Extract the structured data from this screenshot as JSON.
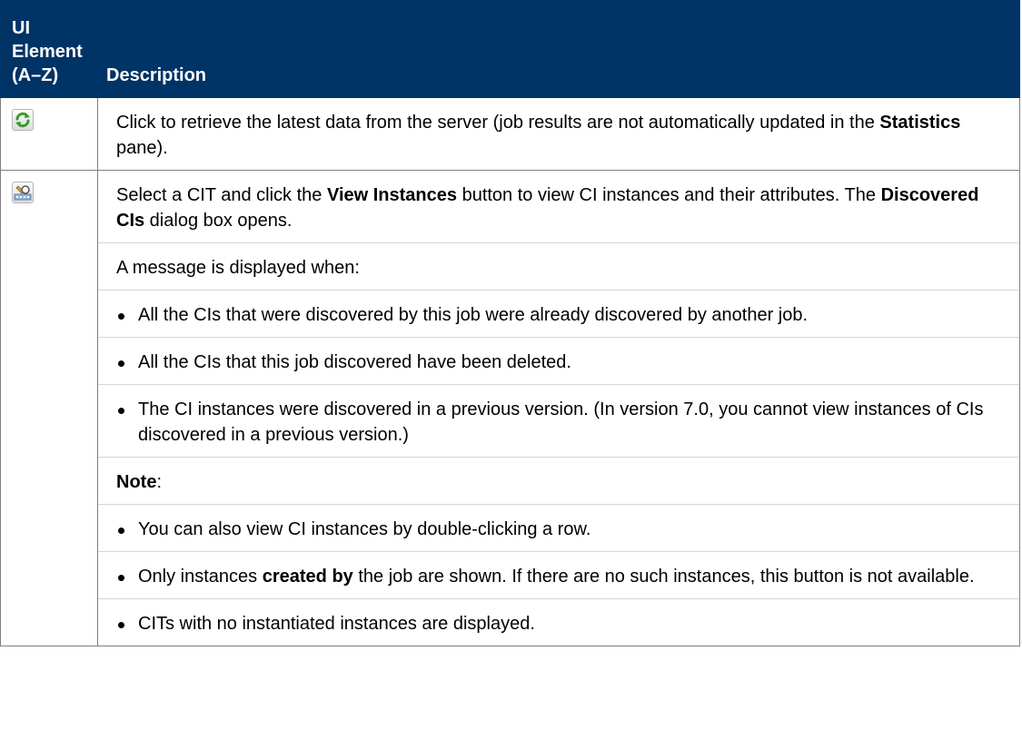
{
  "header": {
    "col1_line1": "UI Element",
    "col1_line2": "(A–Z)",
    "col2": "Description"
  },
  "rows": [
    {
      "icon": "refresh-icon",
      "text_a": "Click to retrieve the latest data from the server (job results are not automatically updated in the ",
      "bold_a": "Statistics",
      "text_b": " pane)."
    },
    {
      "icon": "view-instances-icon",
      "intro_a": "Select a CIT and click the ",
      "intro_bold_a": "View Instances",
      "intro_b": " button to view CI instances and their attributes. The ",
      "intro_bold_b": "Discovered CIs",
      "intro_c": " dialog box opens.",
      "message_intro": "A message is displayed when:",
      "message_bullets": [
        "All the CIs that were discovered by this job were already discovered by another job.",
        "All the CIs that this job discovered have been deleted.",
        "The CI instances were discovered in a previous version. (In version 7.0, you cannot view instances of CIs discovered in a previous version.)"
      ],
      "note_label": "Note",
      "note_colon": ":",
      "note_bullet_1": "You can also view CI instances by double-clicking a row.",
      "note_bullet_2_a": "Only instances ",
      "note_bullet_2_bold": "created by",
      "note_bullet_2_b": " the job are shown. If there are no such instances, this button is not available.",
      "note_bullet_3": "CITs with no instantiated instances are displayed."
    }
  ],
  "colors": {
    "header_bg": "#003366",
    "header_text": "#ffffff",
    "border": "#7f7f7f",
    "separator": "#d6d6d6"
  }
}
